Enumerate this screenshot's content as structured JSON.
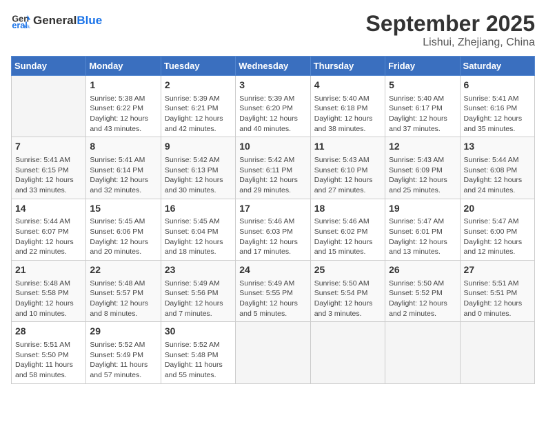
{
  "header": {
    "logo_line1": "General",
    "logo_line2": "Blue",
    "month": "September 2025",
    "location": "Lishui, Zhejiang, China"
  },
  "days_of_week": [
    "Sunday",
    "Monday",
    "Tuesday",
    "Wednesday",
    "Thursday",
    "Friday",
    "Saturday"
  ],
  "weeks": [
    [
      {
        "day": "",
        "info": ""
      },
      {
        "day": "1",
        "info": "Sunrise: 5:38 AM\nSunset: 6:22 PM\nDaylight: 12 hours\nand 43 minutes."
      },
      {
        "day": "2",
        "info": "Sunrise: 5:39 AM\nSunset: 6:21 PM\nDaylight: 12 hours\nand 42 minutes."
      },
      {
        "day": "3",
        "info": "Sunrise: 5:39 AM\nSunset: 6:20 PM\nDaylight: 12 hours\nand 40 minutes."
      },
      {
        "day": "4",
        "info": "Sunrise: 5:40 AM\nSunset: 6:18 PM\nDaylight: 12 hours\nand 38 minutes."
      },
      {
        "day": "5",
        "info": "Sunrise: 5:40 AM\nSunset: 6:17 PM\nDaylight: 12 hours\nand 37 minutes."
      },
      {
        "day": "6",
        "info": "Sunrise: 5:41 AM\nSunset: 6:16 PM\nDaylight: 12 hours\nand 35 minutes."
      }
    ],
    [
      {
        "day": "7",
        "info": "Sunrise: 5:41 AM\nSunset: 6:15 PM\nDaylight: 12 hours\nand 33 minutes."
      },
      {
        "day": "8",
        "info": "Sunrise: 5:41 AM\nSunset: 6:14 PM\nDaylight: 12 hours\nand 32 minutes."
      },
      {
        "day": "9",
        "info": "Sunrise: 5:42 AM\nSunset: 6:13 PM\nDaylight: 12 hours\nand 30 minutes."
      },
      {
        "day": "10",
        "info": "Sunrise: 5:42 AM\nSunset: 6:11 PM\nDaylight: 12 hours\nand 29 minutes."
      },
      {
        "day": "11",
        "info": "Sunrise: 5:43 AM\nSunset: 6:10 PM\nDaylight: 12 hours\nand 27 minutes."
      },
      {
        "day": "12",
        "info": "Sunrise: 5:43 AM\nSunset: 6:09 PM\nDaylight: 12 hours\nand 25 minutes."
      },
      {
        "day": "13",
        "info": "Sunrise: 5:44 AM\nSunset: 6:08 PM\nDaylight: 12 hours\nand 24 minutes."
      }
    ],
    [
      {
        "day": "14",
        "info": "Sunrise: 5:44 AM\nSunset: 6:07 PM\nDaylight: 12 hours\nand 22 minutes."
      },
      {
        "day": "15",
        "info": "Sunrise: 5:45 AM\nSunset: 6:06 PM\nDaylight: 12 hours\nand 20 minutes."
      },
      {
        "day": "16",
        "info": "Sunrise: 5:45 AM\nSunset: 6:04 PM\nDaylight: 12 hours\nand 18 minutes."
      },
      {
        "day": "17",
        "info": "Sunrise: 5:46 AM\nSunset: 6:03 PM\nDaylight: 12 hours\nand 17 minutes."
      },
      {
        "day": "18",
        "info": "Sunrise: 5:46 AM\nSunset: 6:02 PM\nDaylight: 12 hours\nand 15 minutes."
      },
      {
        "day": "19",
        "info": "Sunrise: 5:47 AM\nSunset: 6:01 PM\nDaylight: 12 hours\nand 13 minutes."
      },
      {
        "day": "20",
        "info": "Sunrise: 5:47 AM\nSunset: 6:00 PM\nDaylight: 12 hours\nand 12 minutes."
      }
    ],
    [
      {
        "day": "21",
        "info": "Sunrise: 5:48 AM\nSunset: 5:58 PM\nDaylight: 12 hours\nand 10 minutes."
      },
      {
        "day": "22",
        "info": "Sunrise: 5:48 AM\nSunset: 5:57 PM\nDaylight: 12 hours\nand 8 minutes."
      },
      {
        "day": "23",
        "info": "Sunrise: 5:49 AM\nSunset: 5:56 PM\nDaylight: 12 hours\nand 7 minutes."
      },
      {
        "day": "24",
        "info": "Sunrise: 5:49 AM\nSunset: 5:55 PM\nDaylight: 12 hours\nand 5 minutes."
      },
      {
        "day": "25",
        "info": "Sunrise: 5:50 AM\nSunset: 5:54 PM\nDaylight: 12 hours\nand 3 minutes."
      },
      {
        "day": "26",
        "info": "Sunrise: 5:50 AM\nSunset: 5:52 PM\nDaylight: 12 hours\nand 2 minutes."
      },
      {
        "day": "27",
        "info": "Sunrise: 5:51 AM\nSunset: 5:51 PM\nDaylight: 12 hours\nand 0 minutes."
      }
    ],
    [
      {
        "day": "28",
        "info": "Sunrise: 5:51 AM\nSunset: 5:50 PM\nDaylight: 11 hours\nand 58 minutes."
      },
      {
        "day": "29",
        "info": "Sunrise: 5:52 AM\nSunset: 5:49 PM\nDaylight: 11 hours\nand 57 minutes."
      },
      {
        "day": "30",
        "info": "Sunrise: 5:52 AM\nSunset: 5:48 PM\nDaylight: 11 hours\nand 55 minutes."
      },
      {
        "day": "",
        "info": ""
      },
      {
        "day": "",
        "info": ""
      },
      {
        "day": "",
        "info": ""
      },
      {
        "day": "",
        "info": ""
      }
    ]
  ]
}
